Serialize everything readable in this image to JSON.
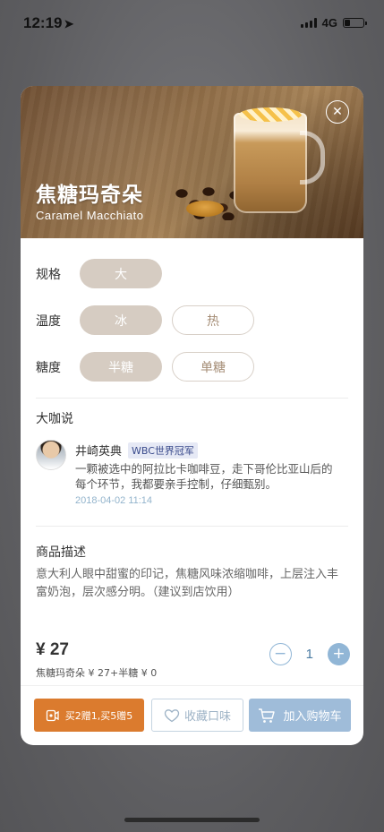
{
  "status_bar": {
    "time": "12:19",
    "network": "4G"
  },
  "product": {
    "name_cn": "焦糖玛奇朵",
    "name_en": "Caramel Macchiato"
  },
  "options": [
    {
      "label": "规格",
      "choices": [
        {
          "text": "大",
          "selected": true
        }
      ]
    },
    {
      "label": "温度",
      "choices": [
        {
          "text": "冰",
          "selected": true
        },
        {
          "text": "热",
          "selected": false
        }
      ]
    },
    {
      "label": "糖度",
      "choices": [
        {
          "text": "半糖",
          "selected": true
        },
        {
          "text": "单糖",
          "selected": false
        }
      ]
    }
  ],
  "review_section": {
    "title": "大咖说",
    "reviewer": "井崎英典",
    "badge": "WBC世界冠军",
    "text": "一颗被选中的阿拉比卡咖啡豆，走下哥伦比亚山后的每个环节，我都要亲手控制，仔细甄别。",
    "date": "2018-04-02 11:14"
  },
  "description": {
    "title": "商品描述",
    "text": "意大利人眼中甜蜜的印记，焦糖风味浓缩咖啡，上层注入丰富奶泡，层次感分明。（建议到店饮用）"
  },
  "price": {
    "amount": "¥ 27",
    "detail": "焦糖玛奇朵 ¥ 27+半糖 ¥ 0"
  },
  "quantity": {
    "value": "1",
    "minus": "−",
    "plus": "+"
  },
  "actions": {
    "promo_label": "买2赠1,买5赠5",
    "favorite_label": "收藏口味",
    "cart_label": "加入购物车"
  },
  "colors": {
    "accent_blue": "#91b6d6",
    "promo_orange": "#db7b2e",
    "selected_pill": "#d6ccc2"
  }
}
